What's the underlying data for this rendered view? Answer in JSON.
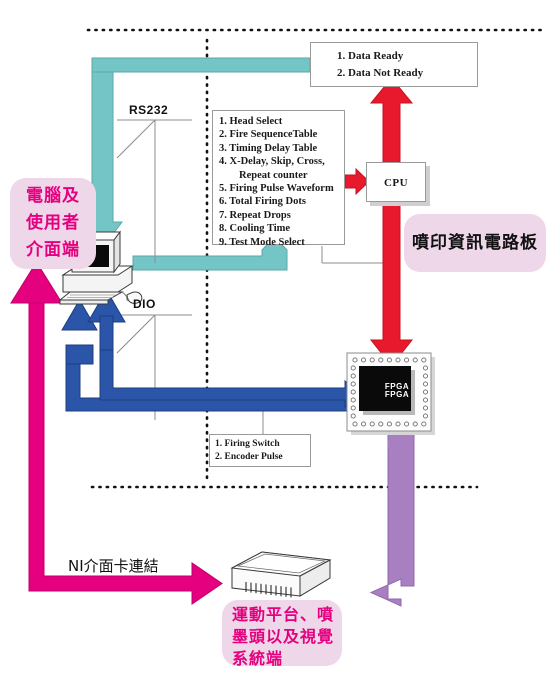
{
  "diagram": {
    "title": "Inkjet printing control system block diagram",
    "colors": {
      "teal": "#74c6c6",
      "red": "#e8192c",
      "blue": "#2a55a8",
      "magenta": "#e5007f",
      "purple": "#a87fc0",
      "pink_panel": "#eed7e8",
      "box_border": "#9a9a9a"
    }
  },
  "zones": {
    "host": {
      "label": "電腦及\n使用者\n介面端",
      "line1": "電腦及",
      "line2": "使用者",
      "line3": "介面端"
    },
    "board": {
      "label": "噴印資訊電路板"
    },
    "stage": {
      "line1": "運動平台、噴",
      "line2": "墨頭以及視覺",
      "line3": "系統端"
    }
  },
  "boxes": {
    "data_ready": {
      "items": [
        "1. Data Ready",
        "2. Data Not Ready"
      ]
    },
    "parameters": {
      "items": [
        "1. Head Select",
        "2. Fire SequenceTable",
        "3. Timing Delay Table",
        "4. X-Delay, Skip, Cross,",
        "Repeat counter",
        "5. Firing Pulse Waveform",
        "6. Total Firing Dots",
        "7. Repeat Drops",
        "8. Cooling Time",
        "9. Test Mode Select"
      ]
    },
    "cpu": {
      "label": "CPU"
    },
    "firing": {
      "items": [
        "1. Firing Switch",
        "2. Encoder Pulse"
      ]
    }
  },
  "labels": {
    "rs232": "RS232",
    "dio": "DIO",
    "ni_link": "NI介面卡連結",
    "fpga_line1": "FPGA",
    "fpga_line2": "FPGA"
  }
}
